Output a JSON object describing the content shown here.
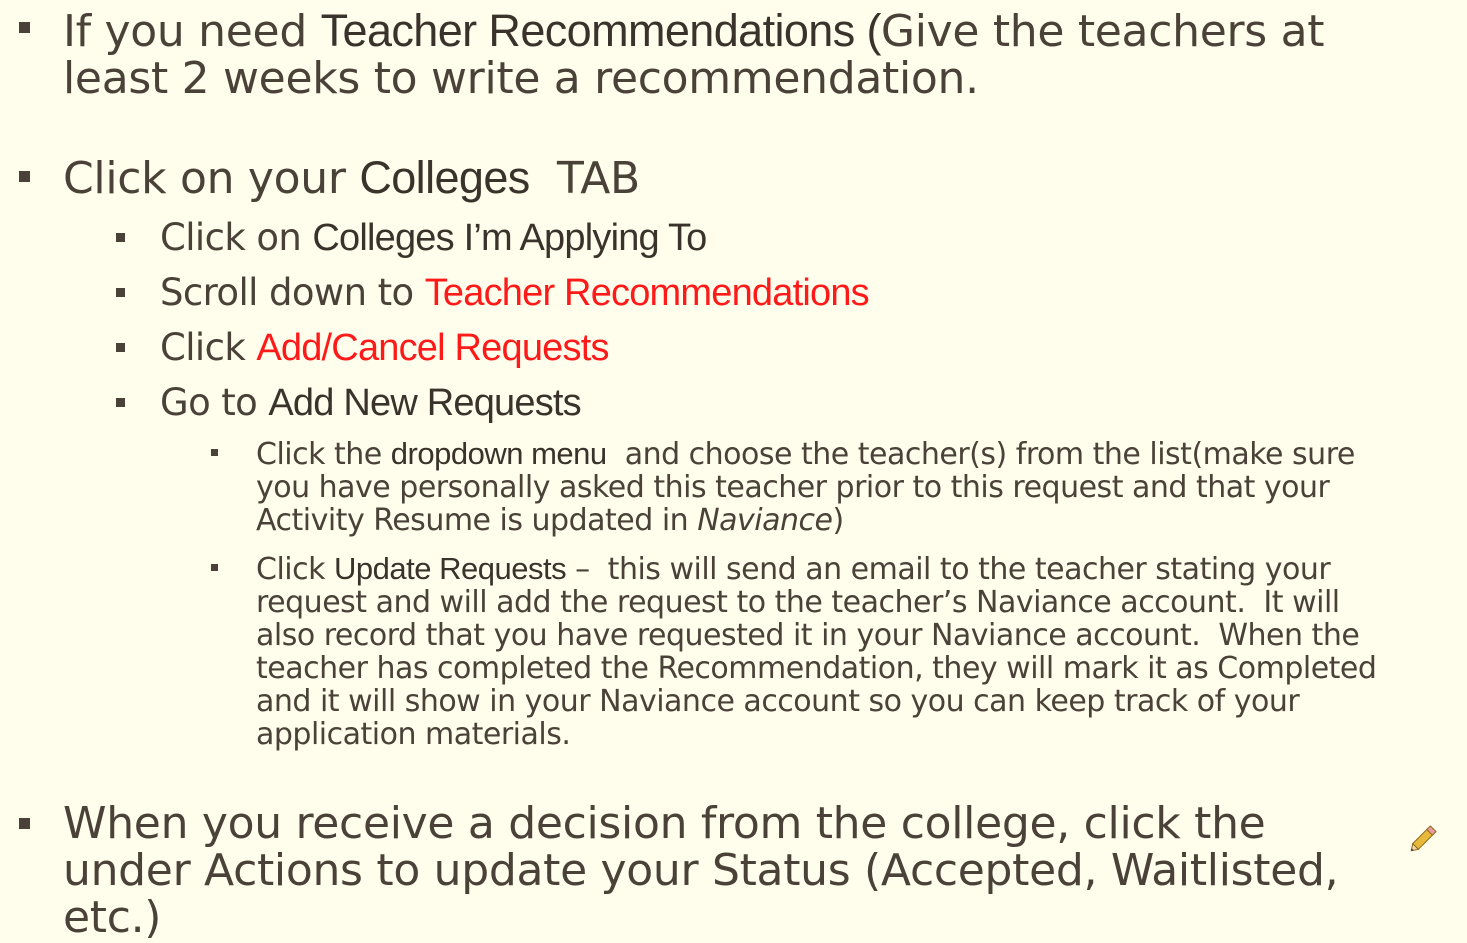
{
  "item1": {
    "prefix": "If you need ",
    "bold": "Teacher Recommendations (",
    "line1_rest": "Give the teachers at",
    "line2": "least 2 weeks to write a recommendation."
  },
  "item2": {
    "prefix": "Click on your ",
    "bold": "Colleges",
    "suffix": "  TAB"
  },
  "sub1": {
    "prefix": "Click on ",
    "bold": "Colleges I’m Applying To"
  },
  "sub2": {
    "prefix": "Scroll down to ",
    "red": "Teacher Recommendations"
  },
  "sub3": {
    "prefix": "Click ",
    "red": "Add/Cancel Requests"
  },
  "sub4": {
    "prefix": "Go to ",
    "bold": "Add New Requests"
  },
  "subsub1": {
    "prefix": "Click the ",
    "bold": "dropdown menu",
    "line1_rest": "  and choose the teacher(s) from the list(make sure",
    "line2": "you have personally asked this teacher prior to this request and that your",
    "line3_prefix": "Activity Resume is updated in ",
    "line3_italic": "Naviance",
    "line3_suffix": ")"
  },
  "subsub2": {
    "prefix": "Click ",
    "bold": "Update Requests",
    "line1_rest": " –  this will send an email to the teacher stating your",
    "line2": "request and will add the request to the teacher’s Naviance account.  It will",
    "line3": "also record that you have requested it in your Naviance account.  When the",
    "line4": "teacher has completed the Recommendation, they will mark it as Completed",
    "line5": "and it will show in your Naviance account so you can keep track of your",
    "line6": "application materials."
  },
  "item3": {
    "line1": "When you receive a decision from the college, click the",
    "line2": "under Actions to update your Status (Accepted, Waitlisted,",
    "line3": "etc.)",
    "icon": "pencil-icon"
  },
  "colors": {
    "background": "#FFFDEB",
    "text": "#4A4238",
    "highlight": "#FF1A1A"
  }
}
